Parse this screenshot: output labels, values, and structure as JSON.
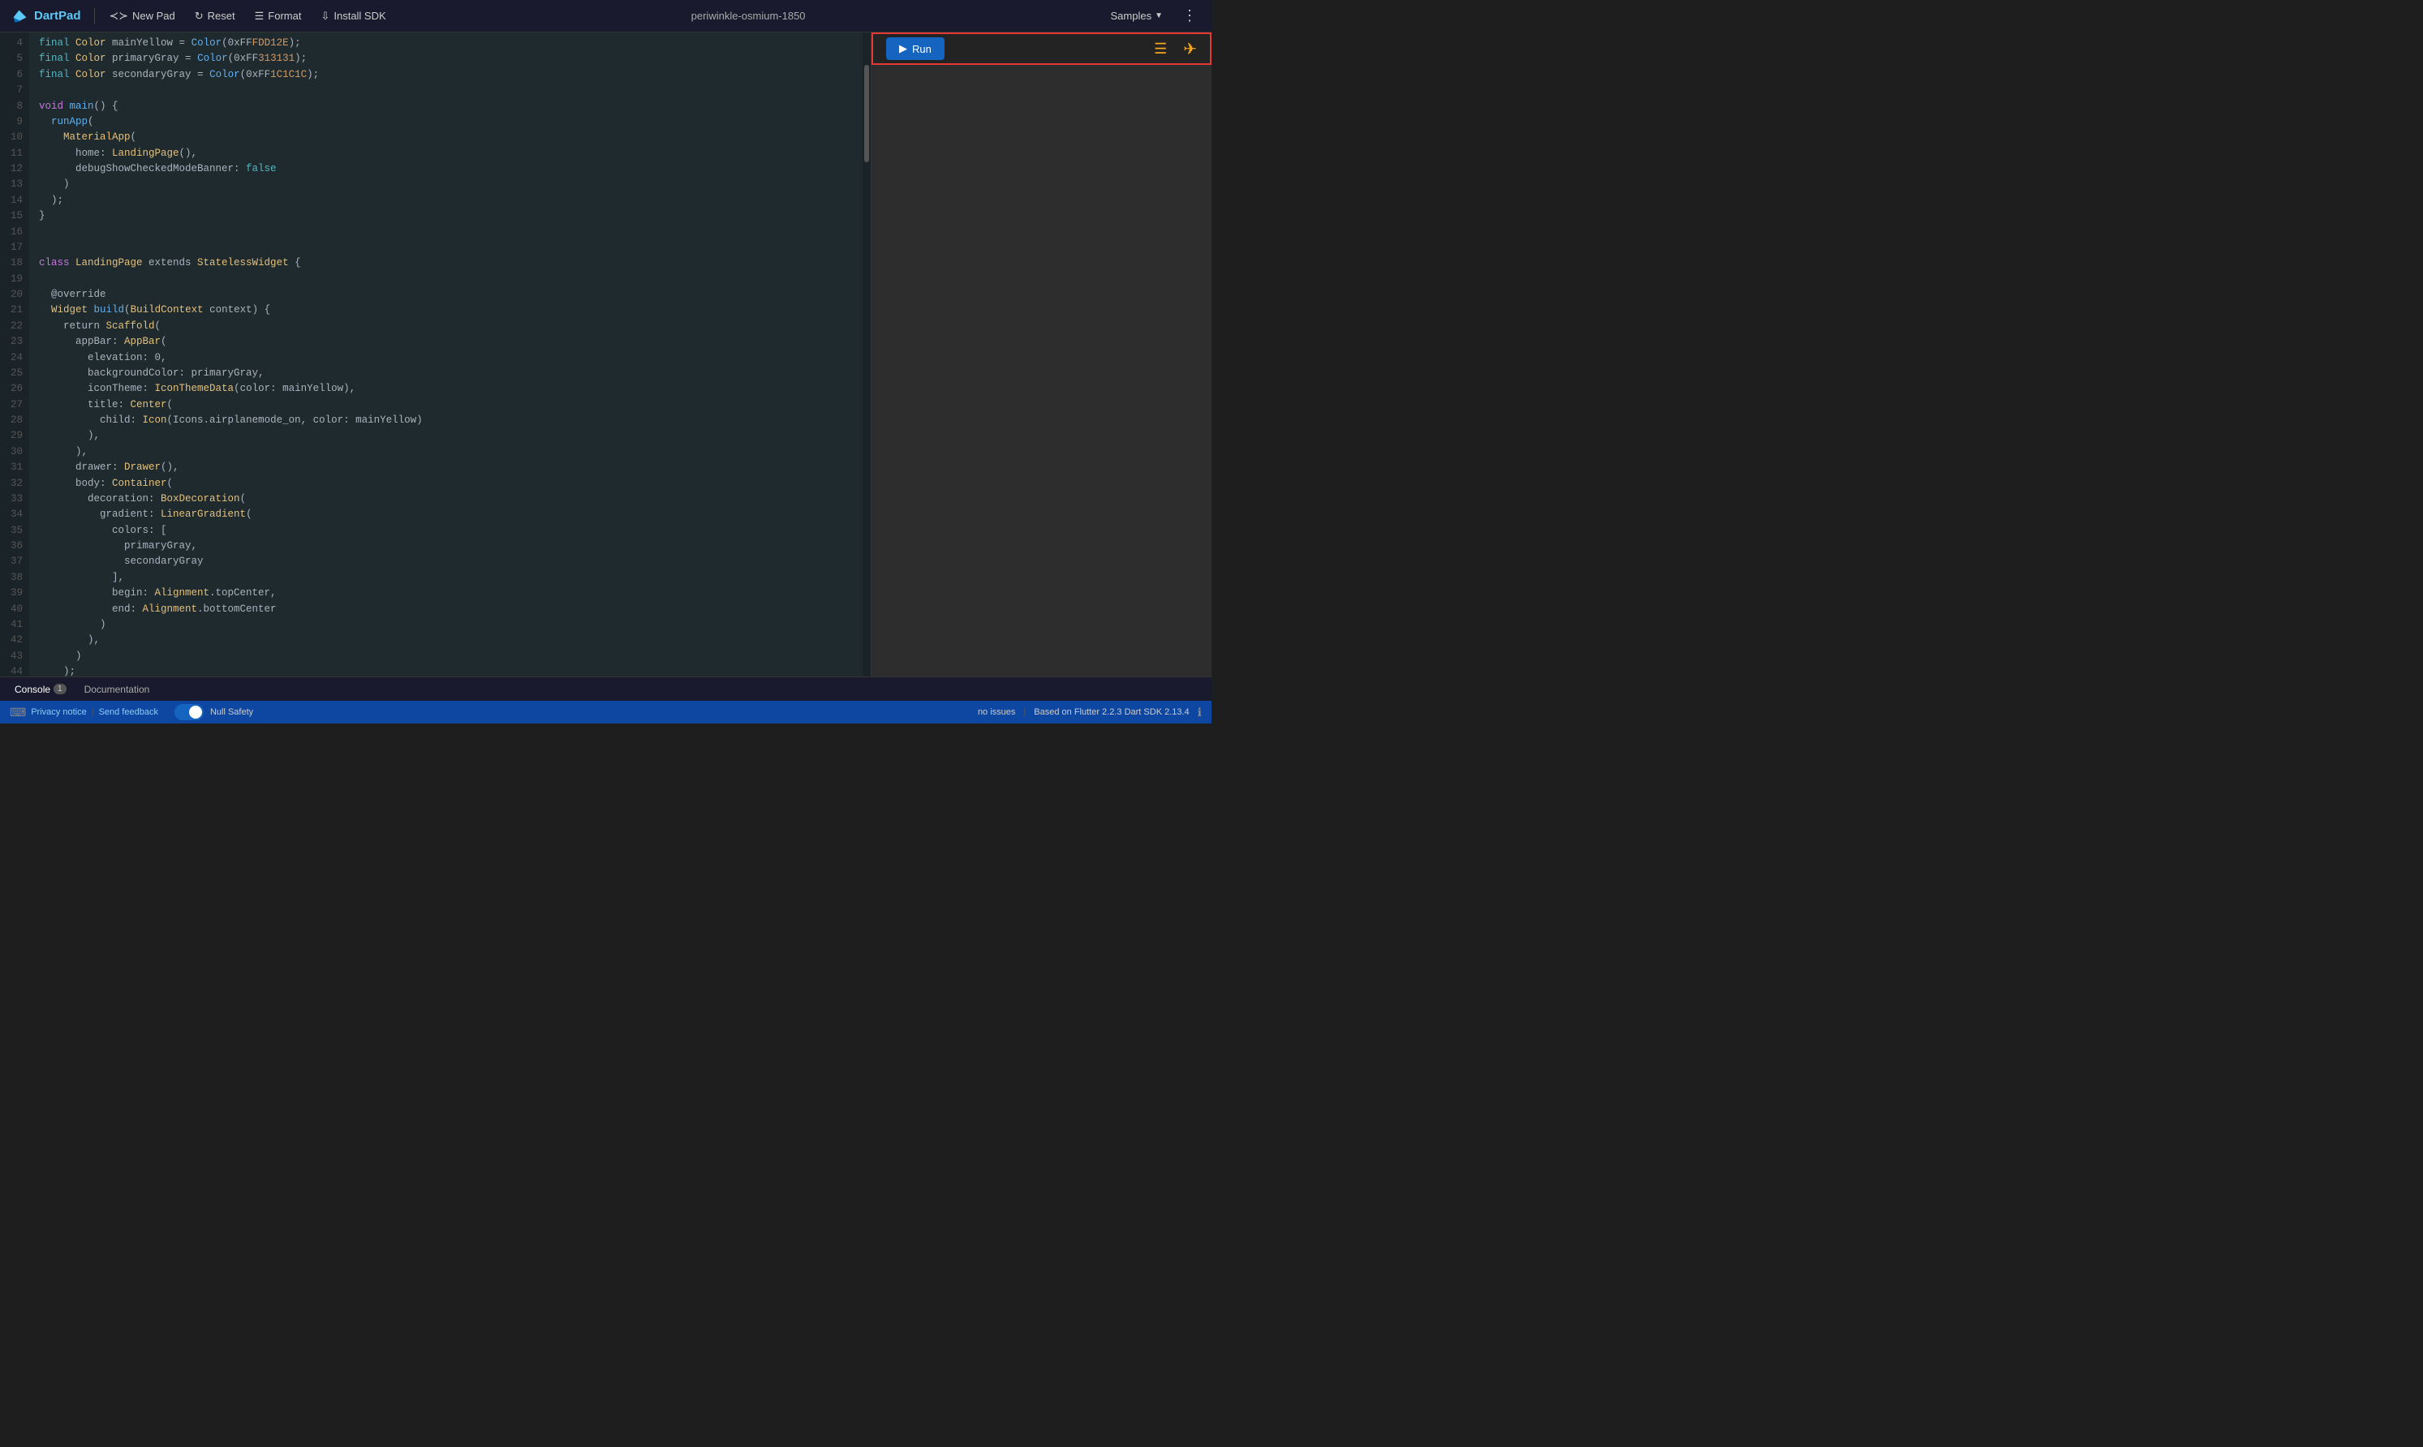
{
  "header": {
    "logo_text": "DartPad",
    "new_pad_label": "New Pad",
    "reset_label": "Reset",
    "format_label": "Format",
    "install_sdk_label": "Install SDK",
    "pad_name": "periwinkle-osmium-1850",
    "samples_label": "Samples",
    "more_icon": "⋮"
  },
  "run_btn": "Run",
  "preview": {
    "hamburger": "☰",
    "airplane": "✈"
  },
  "bottom": {
    "console_label": "Console",
    "console_badge": "1",
    "documentation_label": "Documentation"
  },
  "status": {
    "left_keyboard": "⌨",
    "privacy_notice": "Privacy notice",
    "send_feedback": "Send feedback",
    "null_safety_label": "Null Safety",
    "issues": "no issues",
    "based_on": "Based on Flutter 2.2.3 Dart SDK 2.13.4",
    "info": "ℹ"
  },
  "code_lines": [
    {
      "num": "4",
      "content": [
        {
          "cls": "teal",
          "t": "final "
        },
        {
          "cls": "type",
          "t": "Color"
        },
        {
          "cls": "plain",
          "t": " mainYellow = "
        },
        {
          "cls": "blue",
          "t": "Color"
        },
        {
          "cls": "plain",
          "t": "(0xFF"
        },
        {
          "cls": "num",
          "t": "FDD12E"
        },
        {
          "cls": "plain",
          "t": ");"
        }
      ]
    },
    {
      "num": "5",
      "content": [
        {
          "cls": "teal",
          "t": "final "
        },
        {
          "cls": "type",
          "t": "Color"
        },
        {
          "cls": "plain",
          "t": " primaryGray = "
        },
        {
          "cls": "blue",
          "t": "Color"
        },
        {
          "cls": "plain",
          "t": "(0xFF"
        },
        {
          "cls": "num",
          "t": "313131"
        },
        {
          "cls": "plain",
          "t": ");"
        }
      ]
    },
    {
      "num": "6",
      "content": [
        {
          "cls": "teal",
          "t": "final "
        },
        {
          "cls": "type",
          "t": "Color"
        },
        {
          "cls": "plain",
          "t": " secondaryGray = "
        },
        {
          "cls": "blue",
          "t": "Color"
        },
        {
          "cls": "plain",
          "t": "(0xFF"
        },
        {
          "cls": "num",
          "t": "1C1C1C"
        },
        {
          "cls": "plain",
          "t": ");"
        }
      ]
    },
    {
      "num": "7",
      "content": []
    },
    {
      "num": "8",
      "content": [
        {
          "cls": "purple",
          "t": "void "
        },
        {
          "cls": "blue",
          "t": "main"
        },
        {
          "cls": "plain",
          "t": "() {"
        }
      ]
    },
    {
      "num": "9",
      "content": [
        {
          "cls": "plain",
          "t": "  "
        },
        {
          "cls": "blue",
          "t": "runApp"
        },
        {
          "cls": "plain",
          "t": "("
        }
      ]
    },
    {
      "num": "10",
      "content": [
        {
          "cls": "plain",
          "t": "    "
        },
        {
          "cls": "type",
          "t": "MaterialApp"
        },
        {
          "cls": "plain",
          "t": "("
        }
      ]
    },
    {
      "num": "11",
      "content": [
        {
          "cls": "plain",
          "t": "      home: "
        },
        {
          "cls": "type",
          "t": "LandingPage"
        },
        {
          "cls": "plain",
          "t": "(),"
        }
      ]
    },
    {
      "num": "12",
      "content": [
        {
          "cls": "plain",
          "t": "      debugShowCheckedModeBanner: "
        },
        {
          "cls": "teal",
          "t": "false"
        }
      ]
    },
    {
      "num": "13",
      "content": [
        {
          "cls": "plain",
          "t": "    )"
        }
      ]
    },
    {
      "num": "14",
      "content": [
        {
          "cls": "plain",
          "t": "  );"
        }
      ]
    },
    {
      "num": "15",
      "content": [
        {
          "cls": "plain",
          "t": "}"
        }
      ]
    },
    {
      "num": "16",
      "content": []
    },
    {
      "num": "17",
      "content": []
    },
    {
      "num": "18",
      "content": [
        {
          "cls": "purple",
          "t": "class "
        },
        {
          "cls": "type",
          "t": "LandingPage"
        },
        {
          "cls": "plain",
          "t": " extends "
        },
        {
          "cls": "type",
          "t": "StatelessWidget"
        },
        {
          "cls": "plain",
          "t": " {"
        }
      ]
    },
    {
      "num": "19",
      "content": []
    },
    {
      "num": "20",
      "content": [
        {
          "cls": "plain",
          "t": "  @override"
        }
      ]
    },
    {
      "num": "21",
      "content": [
        {
          "cls": "type",
          "t": "  Widget"
        },
        {
          "cls": "plain",
          "t": " "
        },
        {
          "cls": "blue",
          "t": "build"
        },
        {
          "cls": "plain",
          "t": "("
        },
        {
          "cls": "type",
          "t": "BuildContext"
        },
        {
          "cls": "plain",
          "t": " context) {"
        }
      ]
    },
    {
      "num": "22",
      "content": [
        {
          "cls": "plain",
          "t": "    return "
        },
        {
          "cls": "type",
          "t": "Scaffold"
        },
        {
          "cls": "plain",
          "t": "("
        }
      ]
    },
    {
      "num": "23",
      "content": [
        {
          "cls": "plain",
          "t": "      appBar: "
        },
        {
          "cls": "type",
          "t": "AppBar"
        },
        {
          "cls": "plain",
          "t": "("
        }
      ]
    },
    {
      "num": "24",
      "content": [
        {
          "cls": "plain",
          "t": "        elevation: 0,"
        }
      ]
    },
    {
      "num": "25",
      "content": [
        {
          "cls": "plain",
          "t": "        backgroundColor: primaryGray,"
        }
      ]
    },
    {
      "num": "26",
      "content": [
        {
          "cls": "plain",
          "t": "        iconTheme: "
        },
        {
          "cls": "type",
          "t": "IconThemeData"
        },
        {
          "cls": "plain",
          "t": "(color: mainYellow),"
        }
      ]
    },
    {
      "num": "27",
      "content": [
        {
          "cls": "plain",
          "t": "        title: "
        },
        {
          "cls": "type",
          "t": "Center"
        },
        {
          "cls": "plain",
          "t": "("
        }
      ]
    },
    {
      "num": "28",
      "content": [
        {
          "cls": "plain",
          "t": "          child: "
        },
        {
          "cls": "type",
          "t": "Icon"
        },
        {
          "cls": "plain",
          "t": "(Icons.airplanemode_on, color: mainYellow)"
        }
      ]
    },
    {
      "num": "29",
      "content": [
        {
          "cls": "plain",
          "t": "        ),"
        }
      ]
    },
    {
      "num": "30",
      "content": [
        {
          "cls": "plain",
          "t": "      ),"
        }
      ]
    },
    {
      "num": "31",
      "content": [
        {
          "cls": "plain",
          "t": "      drawer: "
        },
        {
          "cls": "type",
          "t": "Drawer"
        },
        {
          "cls": "plain",
          "t": "(),"
        }
      ]
    },
    {
      "num": "32",
      "content": [
        {
          "cls": "plain",
          "t": "      body: "
        },
        {
          "cls": "type",
          "t": "Container"
        },
        {
          "cls": "plain",
          "t": "("
        }
      ]
    },
    {
      "num": "33",
      "content": [
        {
          "cls": "plain",
          "t": "        decoration: "
        },
        {
          "cls": "type",
          "t": "BoxDecoration"
        },
        {
          "cls": "plain",
          "t": "("
        }
      ]
    },
    {
      "num": "34",
      "content": [
        {
          "cls": "plain",
          "t": "          gradient: "
        },
        {
          "cls": "type",
          "t": "LinearGradient"
        },
        {
          "cls": "plain",
          "t": "("
        }
      ]
    },
    {
      "num": "35",
      "content": [
        {
          "cls": "plain",
          "t": "            colors: ["
        }
      ]
    },
    {
      "num": "36",
      "content": [
        {
          "cls": "plain",
          "t": "              primaryGray,"
        }
      ]
    },
    {
      "num": "37",
      "content": [
        {
          "cls": "plain",
          "t": "              secondaryGray"
        }
      ]
    },
    {
      "num": "38",
      "content": [
        {
          "cls": "plain",
          "t": "            ],"
        }
      ]
    },
    {
      "num": "39",
      "content": [
        {
          "cls": "plain",
          "t": "            begin: "
        },
        {
          "cls": "type",
          "t": "Alignment"
        },
        {
          "cls": "plain",
          "t": ".topCenter,"
        }
      ]
    },
    {
      "num": "40",
      "content": [
        {
          "cls": "plain",
          "t": "            end: "
        },
        {
          "cls": "type",
          "t": "Alignment"
        },
        {
          "cls": "plain",
          "t": ".bottomCenter"
        }
      ]
    },
    {
      "num": "41",
      "content": [
        {
          "cls": "plain",
          "t": "          )"
        }
      ]
    },
    {
      "num": "42",
      "content": [
        {
          "cls": "plain",
          "t": "        ),"
        }
      ]
    },
    {
      "num": "43",
      "content": [
        {
          "cls": "plain",
          "t": "      )"
        }
      ]
    },
    {
      "num": "44",
      "content": [
        {
          "cls": "plain",
          "t": "    );"
        }
      ]
    }
  ]
}
